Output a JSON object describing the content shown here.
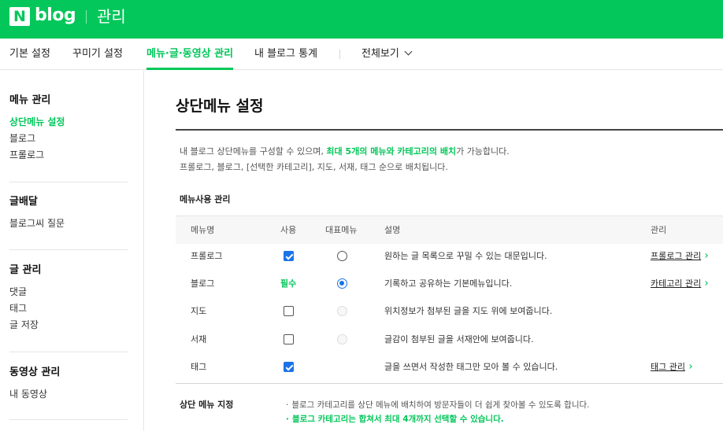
{
  "header": {
    "logo_n": "N",
    "logo_text": "blog",
    "section_title": "관리"
  },
  "nav": {
    "items": [
      {
        "label": "기본 설정"
      },
      {
        "label": "꾸미기 설정"
      },
      {
        "label": "메뉴·글·동영상 관리",
        "active": true
      },
      {
        "label": "내 블로그 통계"
      },
      {
        "label": "전체보기"
      }
    ]
  },
  "sidebar": {
    "groups": [
      {
        "title": "메뉴 관리",
        "items": [
          "상단메뉴 설정",
          "블로그",
          "프롤로그"
        ],
        "active_index": 0
      },
      {
        "title": "글배달",
        "items": [
          "블로그씨 질문"
        ]
      },
      {
        "title": "글 관리",
        "items": [
          "댓글",
          "태그",
          "글 저장"
        ]
      },
      {
        "title": "동영상 관리",
        "items": [
          "내 동영상"
        ]
      }
    ]
  },
  "main": {
    "title": "상단메뉴 설정",
    "desc1_pre": "내 블로그 상단메뉴를 구성할 수 있으며, ",
    "desc1_hl": "최대 5개의 메뉴와 카테고리의 배치",
    "desc1_post": "가 가능합니다.",
    "desc2": "프롤로그, 블로그, [선택한 카테고리], 지도, 서재, 태그 순으로 배치됩니다.",
    "subtitle": "메뉴사용 관리",
    "table": {
      "headers": [
        "메뉴명",
        "사용",
        "대표메뉴",
        "설명",
        "관리"
      ],
      "rows": [
        {
          "name": "프롤로그",
          "use": "checked",
          "rep": "radio",
          "desc": "원하는 글 목록으로 꾸밀 수 있는 대문입니다.",
          "manage": "프롤로그 관리"
        },
        {
          "name": "블로그",
          "use_text": "필수",
          "rep": "radio-selected",
          "desc": "기록하고 공유하는 기본메뉴입니다.",
          "manage": "카테고리 관리"
        },
        {
          "name": "지도",
          "use": "unchecked",
          "rep": "radio-disabled",
          "desc": "위치정보가 첨부된 글을 지도 위에 보여줍니다.",
          "manage": ""
        },
        {
          "name": "서재",
          "use": "unchecked",
          "rep": "radio-disabled",
          "desc": "글감이 첨부된 글을 서재안에 보여줍니다.",
          "manage": ""
        },
        {
          "name": "태그",
          "use": "checked",
          "rep": "none",
          "desc": "글을 쓰면서 작성한 태그만 모아 볼 수 있습니다.",
          "manage": "태그 관리"
        }
      ]
    },
    "section2_title": "상단 메뉴 지정",
    "note_bullet": "·",
    "note1": "블로그 카테고리를 상단 메뉴에 배치하여 방문자들이 더 쉽게 찾아볼 수 있도록 합니다.",
    "note2": "블로그 카테고리는 합쳐서 최대 4개까지 선택할 수 있습니다."
  },
  "colors": {
    "brand": "#03c75a",
    "control": "#1a73e8"
  }
}
